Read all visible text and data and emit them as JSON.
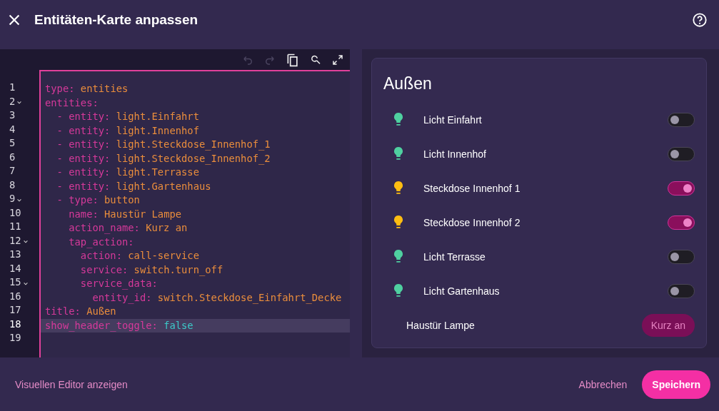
{
  "dialog": {
    "title": "Entitäten-Karte anpassen"
  },
  "editor": {
    "lines": [
      {
        "number": "1",
        "foldable": false,
        "selected": false,
        "key": "type:",
        "value": "entities",
        "kind": "string"
      },
      {
        "number": "2",
        "foldable": true,
        "selected": false,
        "key": "entities:",
        "kind": "none"
      },
      {
        "number": "3",
        "foldable": false,
        "selected": false,
        "key": "  - entity:",
        "value": "light.Einfahrt",
        "kind": "string"
      },
      {
        "number": "4",
        "foldable": false,
        "selected": false,
        "key": "  - entity:",
        "value": "light.Innenhof",
        "kind": "string"
      },
      {
        "number": "5",
        "foldable": false,
        "selected": false,
        "key": "  - entity:",
        "value": "light.Steckdose_Innenhof_1",
        "kind": "string"
      },
      {
        "number": "6",
        "foldable": false,
        "selected": false,
        "key": "  - entity:",
        "value": "light.Steckdose_Innenhof_2",
        "kind": "string"
      },
      {
        "number": "7",
        "foldable": false,
        "selected": false,
        "key": "  - entity:",
        "value": "light.Terrasse",
        "kind": "string"
      },
      {
        "number": "8",
        "foldable": false,
        "selected": false,
        "key": "  - entity:",
        "value": "light.Gartenhaus",
        "kind": "string"
      },
      {
        "number": "9",
        "foldable": true,
        "selected": false,
        "key": "  - type:",
        "value": "button",
        "kind": "string"
      },
      {
        "number": "10",
        "foldable": false,
        "selected": false,
        "key": "    name:",
        "value": "Haustür Lampe",
        "kind": "string"
      },
      {
        "number": "11",
        "foldable": false,
        "selected": false,
        "key": "    action_name:",
        "value": "Kurz an",
        "kind": "string"
      },
      {
        "number": "12",
        "foldable": true,
        "selected": false,
        "key": "    tap_action:",
        "kind": "none"
      },
      {
        "number": "13",
        "foldable": false,
        "selected": false,
        "key": "      action:",
        "value": "call-service",
        "kind": "string"
      },
      {
        "number": "14",
        "foldable": false,
        "selected": false,
        "key": "      service:",
        "value": "switch.turn_off",
        "kind": "string"
      },
      {
        "number": "15",
        "foldable": true,
        "selected": false,
        "key": "      service_data:",
        "kind": "none"
      },
      {
        "number": "16",
        "foldable": false,
        "selected": false,
        "key": "        entity_id:",
        "value": "switch.Steckdose_Einfahrt_Decke",
        "kind": "string"
      },
      {
        "number": "17",
        "foldable": false,
        "selected": false,
        "key": "title:",
        "value": "Außen",
        "kind": "string"
      },
      {
        "number": "18",
        "foldable": false,
        "selected": true,
        "key": "show_header_toggle:",
        "value": "false",
        "kind": "boolean"
      },
      {
        "number": "19",
        "foldable": false,
        "selected": false,
        "kind": "none"
      }
    ]
  },
  "preview": {
    "title": "Außen",
    "rows": [
      {
        "kind": "toggle",
        "name": "Licht Einfahrt",
        "on": false
      },
      {
        "kind": "toggle",
        "name": "Licht Innenhof",
        "on": false
      },
      {
        "kind": "toggle",
        "name": "Steckdose Innenhof 1",
        "on": true
      },
      {
        "kind": "toggle",
        "name": "Steckdose Innenhof 2",
        "on": true
      },
      {
        "kind": "toggle",
        "name": "Licht Terrasse",
        "on": false
      },
      {
        "kind": "toggle",
        "name": "Licht Gartenhaus",
        "on": false
      },
      {
        "kind": "button",
        "name": "Haustür Lampe",
        "action": "Kurz an"
      }
    ]
  },
  "footer": {
    "toggle_editor": "Visuellen Editor anzeigen",
    "cancel": "Abbrechen",
    "save": "Speichern"
  }
}
